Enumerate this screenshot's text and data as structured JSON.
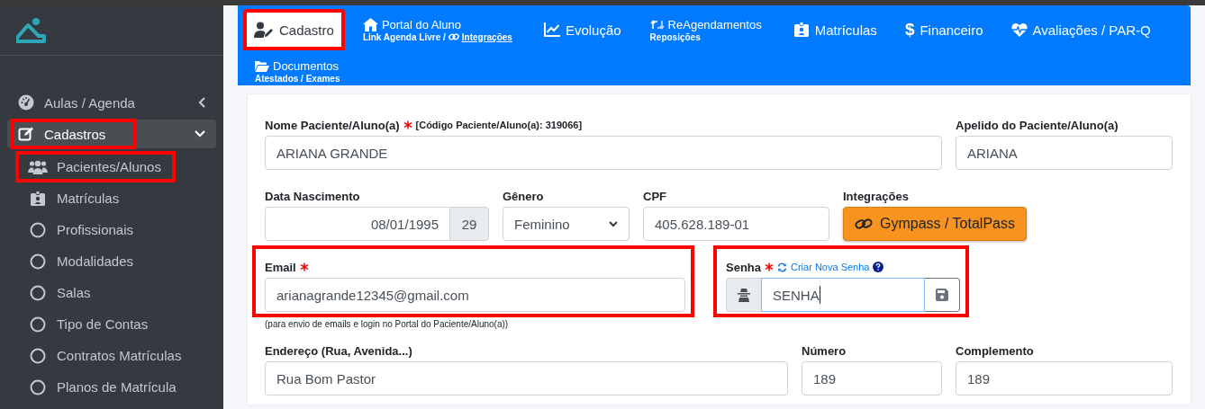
{
  "sidebar": {
    "menu": [
      {
        "label": "Aulas / Agenda",
        "expanded": false,
        "annotated": false
      },
      {
        "label": "Cadastros",
        "expanded": true,
        "annotated": true,
        "children": [
          {
            "label": "Pacientes/Alunos",
            "annotated": true
          },
          {
            "label": "Matrículas",
            "annotated": false
          },
          {
            "label": "Profissionais",
            "annotated": false
          },
          {
            "label": "Modalidades",
            "annotated": false
          },
          {
            "label": "Salas",
            "annotated": false
          },
          {
            "label": "Tipo de Contas",
            "annotated": false
          },
          {
            "label": "Contratos Matrículas",
            "annotated": false
          },
          {
            "label": "Planos de Matrícula",
            "annotated": false
          }
        ]
      }
    ]
  },
  "tabs": [
    {
      "label": "Cadastro",
      "selected": true,
      "annotated": true
    },
    {
      "label": "Portal do Aluno",
      "subtitle": "Link Agenda Livre / ",
      "subtitle_link": "Integrações",
      "selected": false,
      "annotated": false
    },
    {
      "label": "Evolução",
      "selected": false,
      "annotated": false
    },
    {
      "label": "ReAgendamentos",
      "subtitle": "Reposições",
      "selected": false,
      "annotated": false
    },
    {
      "label": "Matrículas",
      "selected": false,
      "annotated": false
    },
    {
      "label": "Financeiro",
      "symbol": "$",
      "selected": false,
      "annotated": false
    },
    {
      "label": "Avaliações / PAR-Q",
      "selected": false,
      "annotated": false
    },
    {
      "label": "Documentos",
      "subtitle": "Atestados / Exames",
      "selected": false,
      "annotated": false
    }
  ],
  "form": {
    "sections": [
      {
        "fields": [
          {
            "kind": "text",
            "label": "Nome Paciente/Aluno(a)",
            "required": true,
            "note": "[Código Paciente/Aluno(a): 319066]",
            "value": "ARIANA GRANDE",
            "annotated": false
          },
          {
            "kind": "text",
            "label": "Apelido do Paciente/Aluno(a)",
            "required": false,
            "value": "ARIANA",
            "annotated": false
          }
        ]
      },
      {
        "fields": [
          {
            "kind": "date",
            "label": "Data Nascimento",
            "required": false,
            "value": "08/01/1995",
            "addon": "29",
            "annotated": false
          },
          {
            "kind": "select",
            "label": "Gênero",
            "required": false,
            "value": "Feminino",
            "annotated": false
          },
          {
            "kind": "text",
            "label": "CPF",
            "required": false,
            "value": "405.628.189-01",
            "annotated": false
          },
          {
            "kind": "button",
            "label": "Integrações",
            "required": false,
            "value": "Gympass / TotalPass",
            "annotated": false
          }
        ]
      },
      {
        "fields": [
          {
            "kind": "text",
            "label": "Email",
            "required": true,
            "value": "arianagrande12345@gmail.com",
            "hint": "(para envio de emails e login no Portal do Paciente/Aluno(a))",
            "annotated": true
          },
          {
            "kind": "password",
            "label": "Senha",
            "required": true,
            "link": "Criar Nova Senha",
            "value": "SENHA",
            "focused": true,
            "annotated": true
          }
        ]
      },
      {
        "fields": [
          {
            "kind": "text",
            "label": "Endereço (Rua, Avenida...)",
            "required": false,
            "value": "Rua Bom Pastor",
            "annotated": false
          },
          {
            "kind": "text",
            "label": "Número",
            "required": false,
            "value": "189",
            "annotated": false
          },
          {
            "kind": "text",
            "label": "Complemento",
            "required": false,
            "value": "189",
            "annotated": false
          }
        ]
      }
    ]
  }
}
